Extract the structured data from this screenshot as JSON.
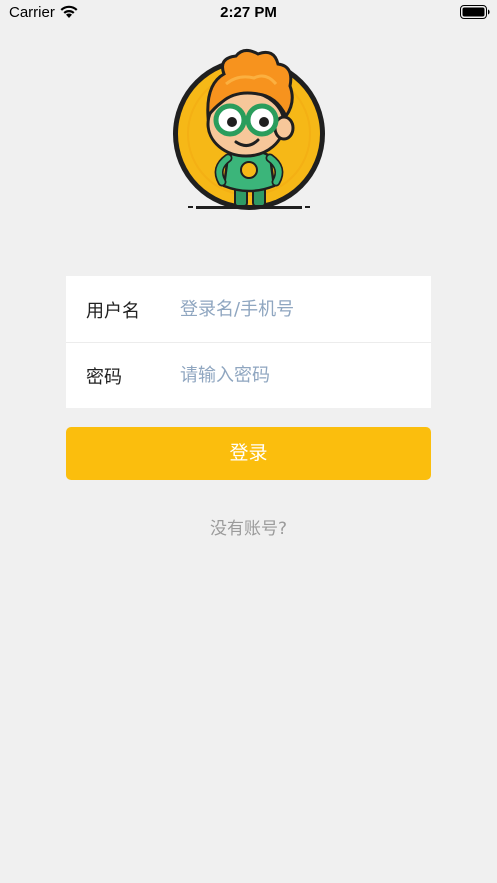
{
  "status_bar": {
    "carrier": "Carrier",
    "time": "2:27 PM",
    "wifi_icon": "wifi-icon",
    "battery_icon": "battery-icon"
  },
  "logo": {
    "icon": "cartoon-mascot-logo",
    "colors": {
      "coin": "#f6b817",
      "hair": "#f7931e",
      "suit": "#3bb57a"
    }
  },
  "form": {
    "username": {
      "label": "用户名",
      "placeholder": "登录名/手机号",
      "value": ""
    },
    "password": {
      "label": "密码",
      "placeholder": "请输入密码",
      "value": ""
    }
  },
  "actions": {
    "login_label": "登录",
    "no_account_label": "没有账号?"
  },
  "colors": {
    "background": "#f0f0f0",
    "accent": "#fbbe0d",
    "placeholder": "#8fa6c0",
    "link": "#9b9b9b"
  }
}
